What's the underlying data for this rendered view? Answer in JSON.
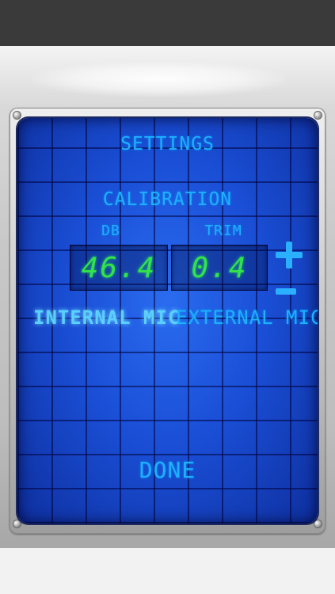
{
  "screen": {
    "title": "SETTINGS",
    "section": "CALIBRATION",
    "columns": {
      "db": "DB",
      "trim": "TRIM"
    },
    "readouts": {
      "db_value": "46.4",
      "trim_value": "0.4"
    },
    "mic_options": [
      {
        "label": "INTERNAL MIC",
        "selected": true
      },
      {
        "label": "EXTERNAL MIC",
        "selected": false
      }
    ],
    "done_label": "DONE"
  },
  "colors": {
    "lcd_text": "#1fb0ff",
    "readout_digits": "#33e34a",
    "screen_bg": "#1a4fd6"
  },
  "icons": {
    "increment": "plus-icon",
    "decrement": "minus-icon"
  }
}
